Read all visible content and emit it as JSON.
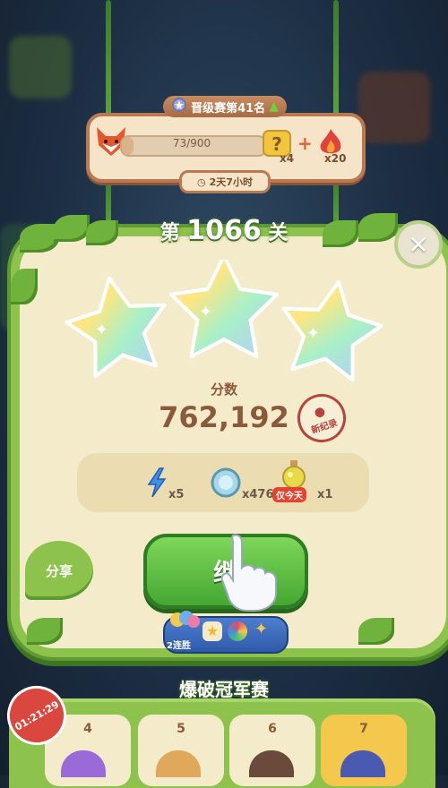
{
  "ranking": {
    "title": "晋级赛第41名",
    "progress_text": "73/900",
    "progress_fraction": 0.081,
    "reward_box_count": "x4",
    "reward_fire_count": "x20",
    "timer": "2天7小时"
  },
  "level": {
    "prefix": "第",
    "number": "1066",
    "suffix": "关",
    "stars": 3
  },
  "score": {
    "label": "分数",
    "value": "762,192",
    "record_badge": "新纪录"
  },
  "rewards": [
    {
      "icon": "lightning-icon",
      "count": "x5"
    },
    {
      "icon": "coin-icon",
      "count": "x4762"
    },
    {
      "icon": "potion-icon",
      "tag": "仅今天",
      "count": "x1"
    }
  ],
  "actions": {
    "share_label": "分享",
    "continue_label": "继"
  },
  "streak": {
    "label": "2连胜"
  },
  "tournament": {
    "title": "爆破冠军赛",
    "countdown": "01:21:29",
    "cards": [
      "4",
      "5",
      "6",
      "7"
    ]
  },
  "colors": {
    "vine_green": "#8dc24c",
    "button_green": "#44a832",
    "panel_cream": "#f4ebcb",
    "score_brown": "#8a5a3a",
    "accent_gold": "#f3c84c"
  }
}
